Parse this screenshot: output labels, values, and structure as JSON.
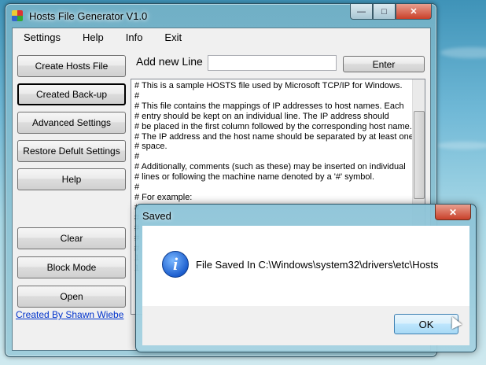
{
  "window": {
    "title": "Hosts File Generator V1.0",
    "min_glyph": "—",
    "max_glyph": "□",
    "close_glyph": "✕"
  },
  "menu": [
    "Settings",
    "Help",
    "Info",
    "Exit"
  ],
  "sidebar": {
    "buttons": [
      "Create Hosts File",
      "Created Back-up",
      "Advanced Settings",
      "Restore Defult Settings",
      "Help",
      "Clear",
      "Block Mode",
      "Open"
    ],
    "credit": "Created By Shawn Wiebe"
  },
  "add_line": {
    "label": "Add new Line",
    "value": "",
    "enter_label": "Enter"
  },
  "hosts_text": "# This is a sample HOSTS file used by Microsoft TCP/IP for Windows.\n#\n# This file contains the mappings of IP addresses to host names. Each\n# entry should be kept on an individual line. The IP address should\n# be placed in the first column followed by the corresponding host name.\n# The IP address and the host name should be separated by at least one\n# space.\n#\n# Additionally, comments (such as these) may be inserted on individual\n# lines or following the machine name denoted by a '#' symbol.\n#\n# For example:\n#\n#\n#\n#\n#\n1\n1",
  "dialog": {
    "title": "Saved",
    "close_glyph": "✕",
    "icon_glyph": "i",
    "message": "File Saved In C:\\Windows\\system32\\drivers\\etc\\Hosts",
    "ok_label": "OK"
  }
}
